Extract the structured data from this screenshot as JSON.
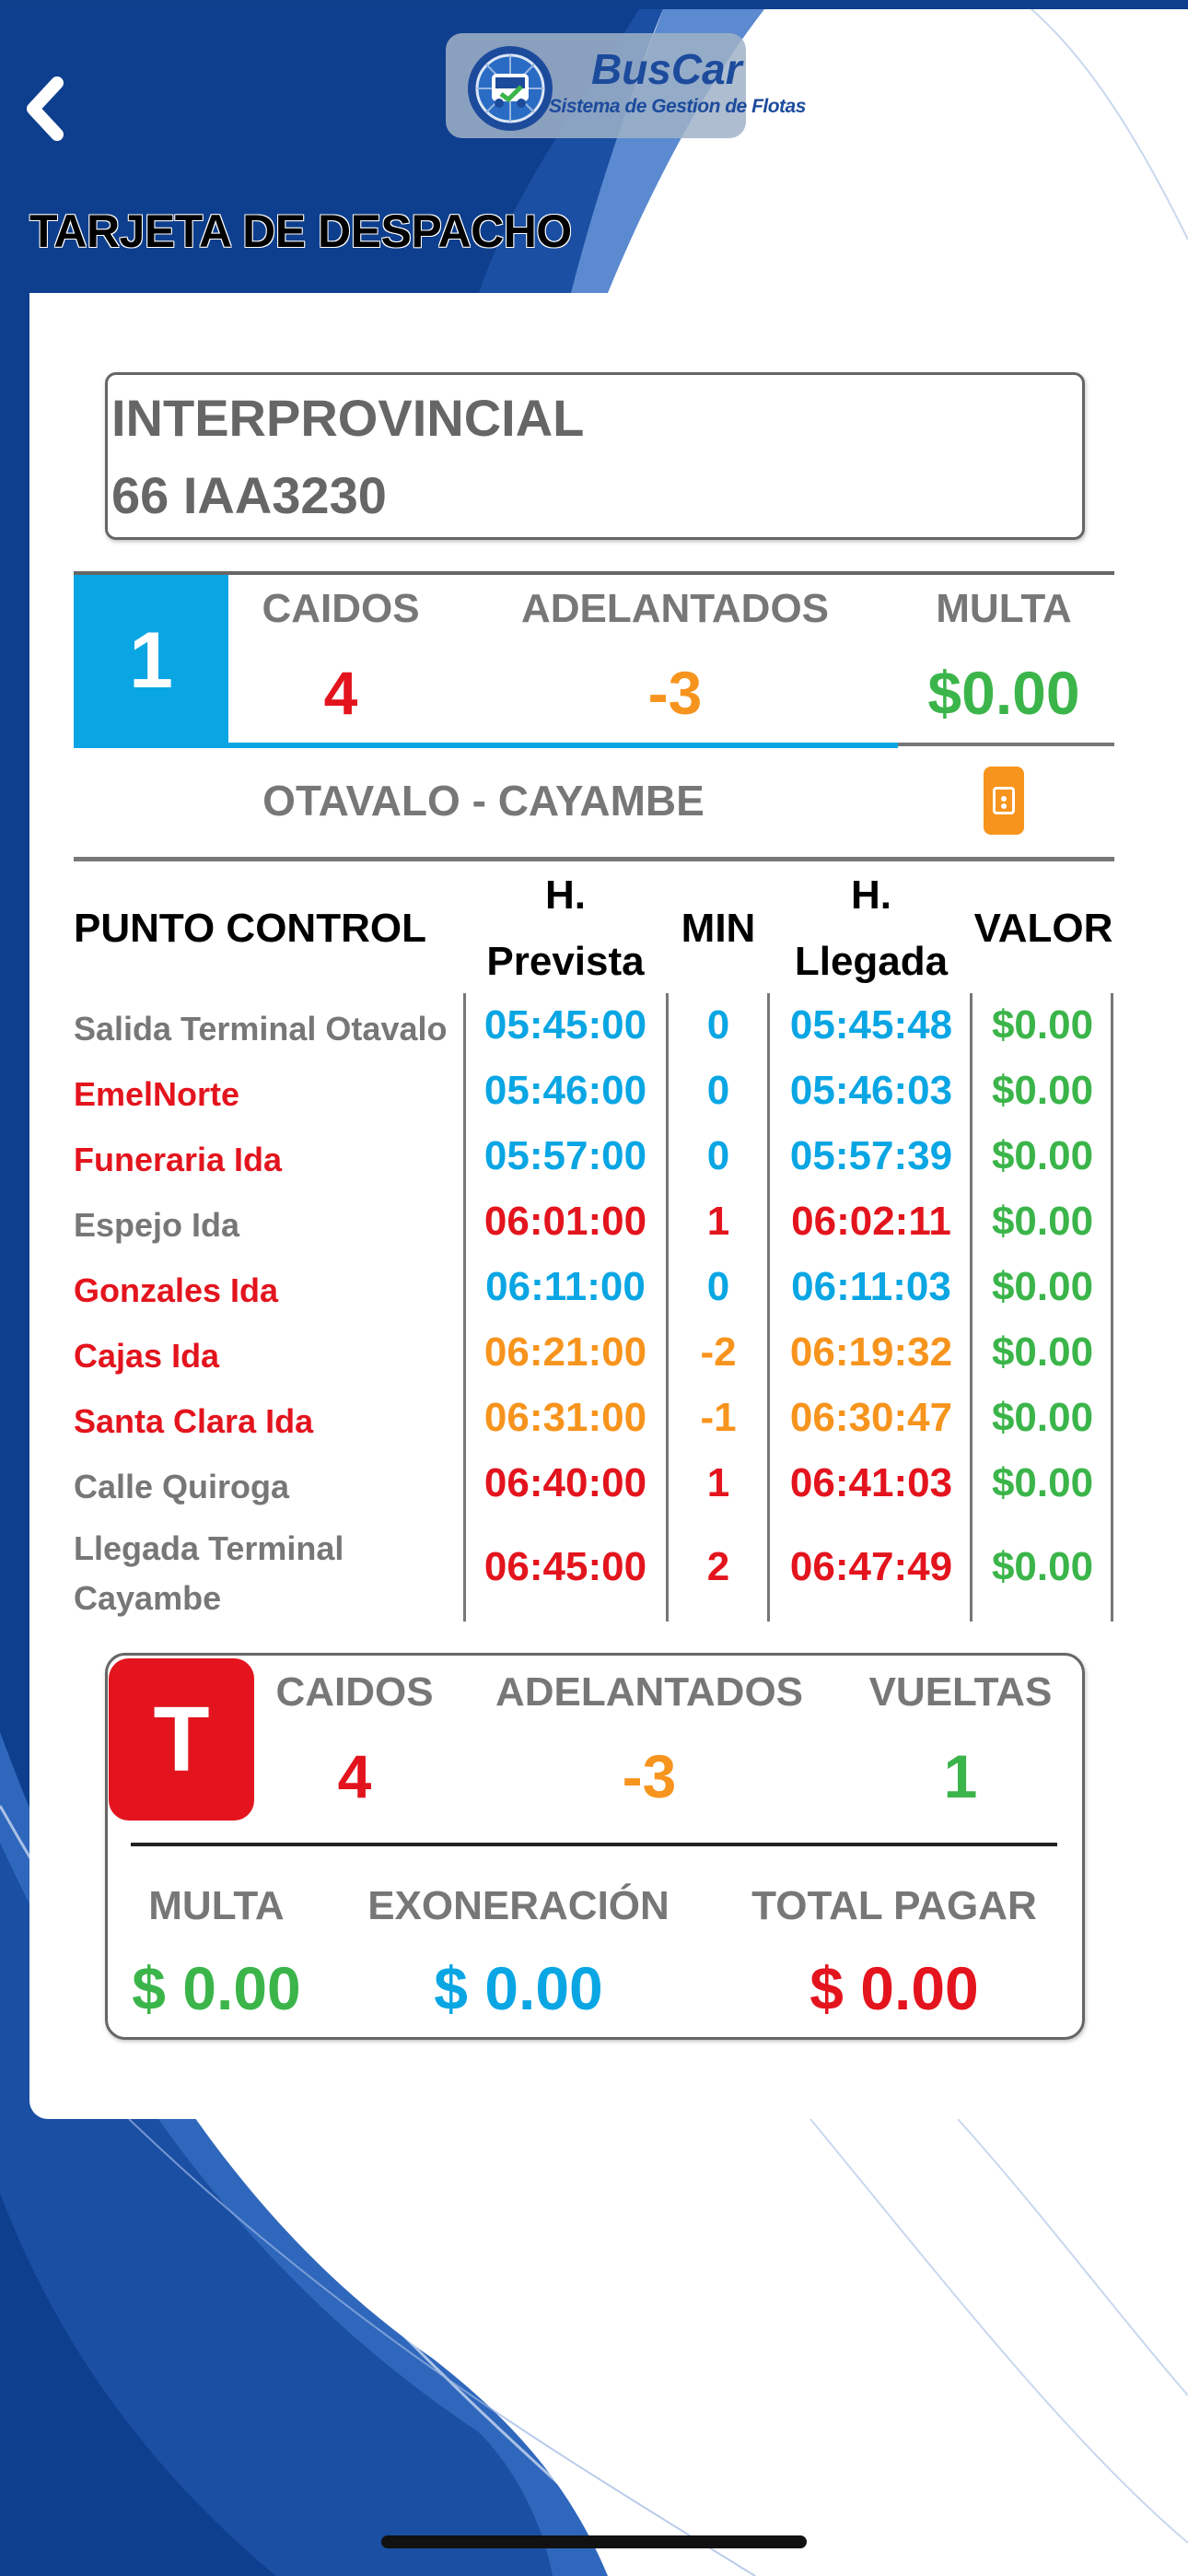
{
  "header": {
    "title": "TARJETA DE DESPACHO",
    "logo": {
      "brand": "BusCar",
      "subtitle": "Sistema de Gestion de Flotas"
    }
  },
  "vehicle": {
    "type": "INTERPROVINCIAL",
    "plate": "66 IAA3230"
  },
  "summary": {
    "number": "1",
    "caidos_label": "CAIDOS",
    "caidos_value": "4",
    "adelantados_label": "ADELANTADOS",
    "adelantados_value": "-3",
    "multa_label": "MULTA",
    "multa_value": "$0.00"
  },
  "route": {
    "name": "OTAVALO - CAYAMBE"
  },
  "table": {
    "headers": {
      "punto": "PUNTO CONTROL",
      "h_prevista_1": "H.",
      "h_prevista_2": "Prevista",
      "min": "MIN",
      "h_llegada_1": "H.",
      "h_llegada_2": "Llegada",
      "valor": "VALOR"
    },
    "rows": [
      {
        "punto": "Salida Terminal Otavalo",
        "prevista": "05:45:00",
        "min": "0",
        "llegada": "05:45:48",
        "valor": "$0.00"
      },
      {
        "punto": "EmelNorte",
        "prevista": "05:46:00",
        "min": "0",
        "llegada": "05:46:03",
        "valor": "$0.00"
      },
      {
        "punto": "Funeraria Ida",
        "prevista": "05:57:00",
        "min": "0",
        "llegada": "05:57:39",
        "valor": "$0.00"
      },
      {
        "punto": "Espejo Ida",
        "prevista": "06:01:00",
        "min": "1",
        "llegada": "06:02:11",
        "valor": "$0.00"
      },
      {
        "punto": "Gonzales Ida",
        "prevista": "06:11:00",
        "min": "0",
        "llegada": "06:11:03",
        "valor": "$0.00"
      },
      {
        "punto": "Cajas Ida",
        "prevista": "06:21:00",
        "min": "-2",
        "llegada": "06:19:32",
        "valor": "$0.00"
      },
      {
        "punto": "Santa Clara Ida",
        "prevista": "06:31:00",
        "min": "-1",
        "llegada": "06:30:47",
        "valor": "$0.00"
      },
      {
        "punto": "Calle Quiroga",
        "prevista": "06:40:00",
        "min": "1",
        "llegada": "06:41:03",
        "valor": "$0.00"
      },
      {
        "punto_1": "Llegada Terminal",
        "punto_2": "Cayambe",
        "prevista": "06:45:00",
        "min": "2",
        "llegada": "06:47:49",
        "valor": "$0.00"
      }
    ]
  },
  "totals": {
    "badge": "T",
    "caidos_label": "CAIDOS",
    "caidos_value": "4",
    "adelantados_label": "ADELANTADOS",
    "adelantados_value": "-3",
    "vueltas_label": "VUELTAS",
    "vueltas_value": "1",
    "multa_label": "MULTA",
    "multa_value": "$ 0.00",
    "exoneracion_label": "EXONERACIÓN",
    "exoneracion_value": "$ 0.00",
    "total_label": "TOTAL PAGAR",
    "total_value": "$ 0.00"
  },
  "colors": {
    "blue": "#0aa6e4",
    "red": "#e3141d",
    "orange": "#f7941d",
    "green": "#3bb54a",
    "gray": "#777777"
  },
  "icons": [
    "back-chevron-icon",
    "bus-logo-icon",
    "ticket-icon"
  ]
}
